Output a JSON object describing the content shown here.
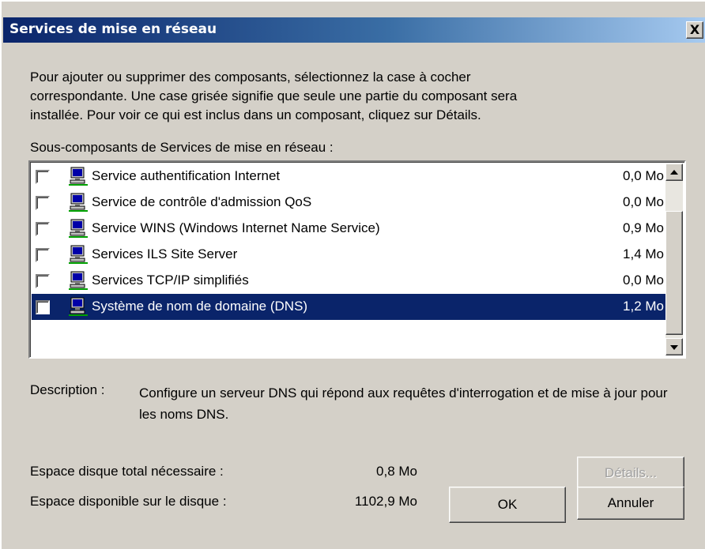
{
  "window": {
    "title": "Services de mise en réseau",
    "close_label": "X"
  },
  "intro_text": "Pour ajouter ou supprimer des composants, sélectionnez la case à cocher\ncorrespondante. Une case grisée signifie que seule une partie du composant sera\ninstallée. Pour voir ce qui est inclus dans un composant, cliquez sur Détails.",
  "list": {
    "label": "Sous-composants de Services de mise en réseau :",
    "items": [
      {
        "name": "Service authentification Internet",
        "size": "0,0 Mo",
        "checked": false,
        "selected": false,
        "icon": "network-computer-icon"
      },
      {
        "name": "Service de contrôle d'admission QoS",
        "size": "0,0 Mo",
        "checked": false,
        "selected": false,
        "icon": "network-computer-icon"
      },
      {
        "name": "Service WINS (Windows Internet Name Service)",
        "size": "0,9 Mo",
        "checked": false,
        "selected": false,
        "icon": "network-computer-icon"
      },
      {
        "name": "Services ILS Site Server",
        "size": "1,4 Mo",
        "checked": false,
        "selected": false,
        "icon": "network-computer-icon"
      },
      {
        "name": "Services TCP/IP simplifiés",
        "size": "0,0 Mo",
        "checked": false,
        "selected": false,
        "icon": "network-computer-icon"
      },
      {
        "name": "Système de nom de domaine (DNS)",
        "size": "1,2 Mo",
        "checked": false,
        "selected": true,
        "icon": "network-computer-icon"
      }
    ]
  },
  "description": {
    "label": "Description :",
    "text": "Configure un serveur DNS qui répond aux requêtes d'interrogation et de mise à jour pour les noms DNS."
  },
  "disk": {
    "required_label": "Espace disque total nécessaire :",
    "required_value": "0,8 Mo",
    "available_label": "Espace disponible sur le disque :",
    "available_value": "1102,9 Mo"
  },
  "buttons": {
    "details": "Détails...",
    "ok": "OK",
    "cancel": "Annuler"
  },
  "colors": {
    "selection": "#0a246a",
    "dialog_face": "#d4d0c8"
  }
}
